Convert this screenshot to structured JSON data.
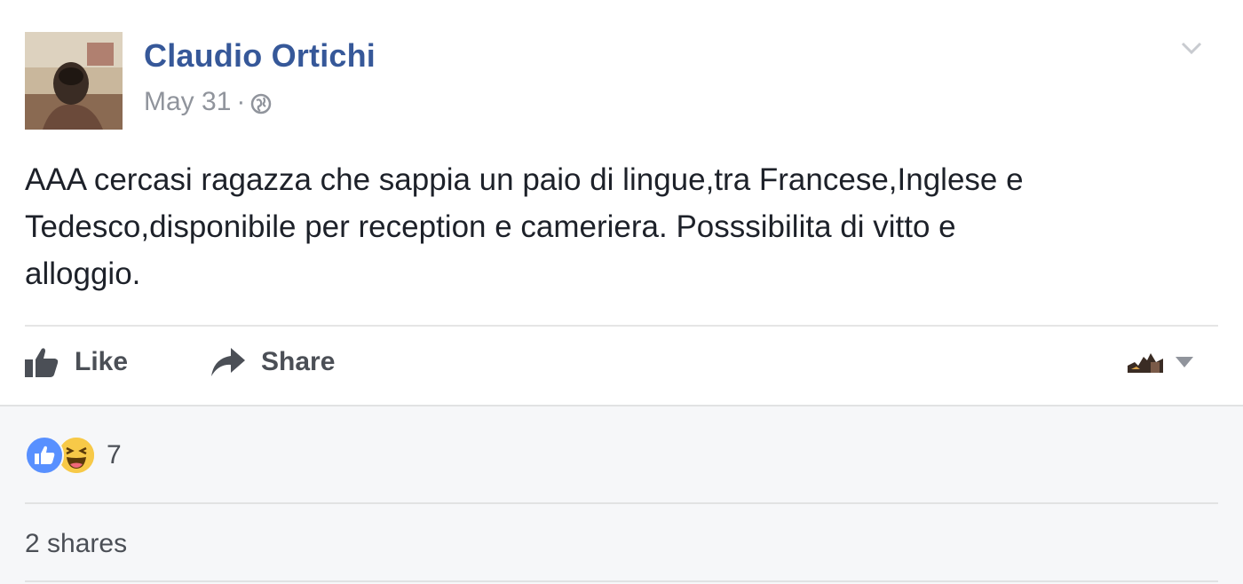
{
  "post": {
    "author": "Claudio Ortichi",
    "date": "May 31",
    "separator": "·",
    "privacy_icon": "globe-icon",
    "text_lines": [
      "AAA cercasi ragazza che sappia un paio di lingue,tra Francese,Inglese e",
      "Tedesco,disponibile per reception e cameriera. Posssibilita di vitto e",
      "alloggio."
    ]
  },
  "actions": {
    "like_label": "Like",
    "share_label": "Share"
  },
  "footer": {
    "reaction_icons": [
      "like-reaction-icon",
      "haha-reaction-icon"
    ],
    "reaction_count": "7",
    "shares_text": "2 shares"
  },
  "colors": {
    "author": "#365899",
    "meta": "#90949c",
    "body_text": "#1d2129",
    "action_text": "#4b4f56",
    "footer_bg": "#f6f7f9",
    "like_reaction": "#5890ff",
    "haha_reaction": "#f7c948"
  }
}
